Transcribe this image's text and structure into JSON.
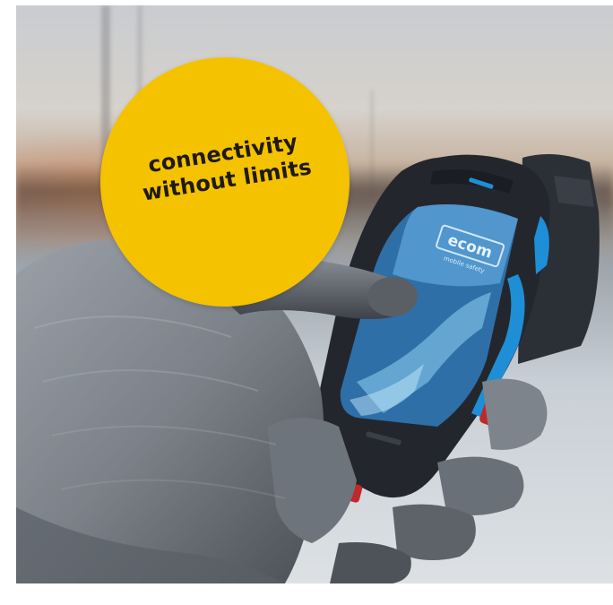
{
  "badge": {
    "line1": "connectivity",
    "line2": "without limits",
    "color": "#f5c200"
  },
  "phone": {
    "brand_logo": "ecom",
    "brand_sublabel": "mobile safety",
    "accent_color": "#1e8fd6"
  },
  "scene": {
    "icons": [
      "yellow-badge",
      "rugged-smartphone",
      "gloved-hand"
    ]
  }
}
